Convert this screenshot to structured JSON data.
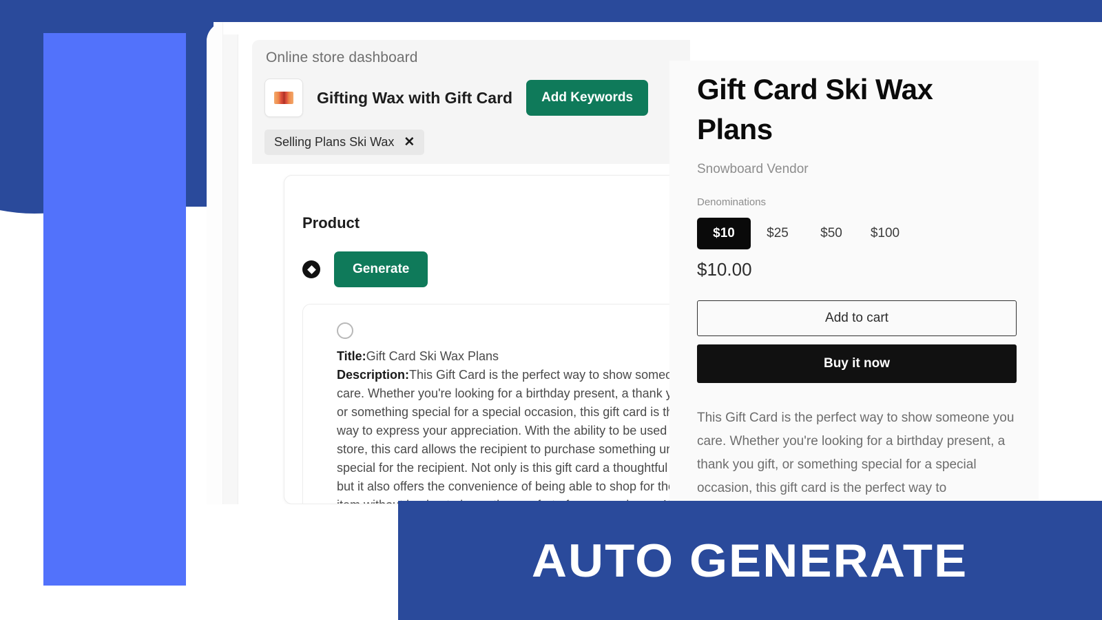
{
  "decor": {
    "dark_blue": "#2a4a9b",
    "light_blue": "#5272fb"
  },
  "dashboard": {
    "page_title": "Online store dashboard",
    "product_thumbnail_icon": "gift-card-icon",
    "product_name": "Gifting Wax with Gift Card",
    "add_keywords_label": "Add Keywords",
    "keyword_tag": {
      "label": "Selling Plans Ski Wax",
      "remove_icon": "✕"
    },
    "card": {
      "heading": "Product",
      "generate_label": "Generate",
      "generate_radio_icon": "selected-radio-icon",
      "result": {
        "radio_icon": "unselected-radio-icon",
        "title_label": "Title:",
        "title_value": "Gift Card Ski Wax Plans",
        "description_label": "Description:",
        "description_value": "This Gift Card is the perfect way to show someone you care. Whether you're looking for a birthday present, a thank you gift, or something special for a special occasion, this gift card is the perfect way to express your appreciation. With the ability to be used at the store, this card allows the recipient to purchase something unique and special for the recipient. Not only is this gift card a thoughtful present, but it also offers the convenience of being able to shop for the perfect item without having to leave the comfort of your own home. With the added bonus of the selling plans and ski wax, the gift card is"
      }
    }
  },
  "storefront": {
    "product_title": "Gift Card Ski Wax Plans",
    "vendor": "Snowboard Vendor",
    "denominations_label": "Denominations",
    "denominations": [
      {
        "label": "$10",
        "selected": true
      },
      {
        "label": "$25",
        "selected": false
      },
      {
        "label": "$50",
        "selected": false
      },
      {
        "label": "$100",
        "selected": false
      }
    ],
    "price": "$10.00",
    "add_to_cart_label": "Add to cart",
    "buy_now_label": "Buy it now",
    "description": "This Gift Card is the perfect way to show someone you care. Whether you're looking for a birthday present, a thank you gift, or something special for a special occasion, this gift card is the perfect way to"
  },
  "banner": {
    "text": "AUTO GENERATE",
    "background": "#2a4a9b",
    "color": "#ffffff"
  }
}
